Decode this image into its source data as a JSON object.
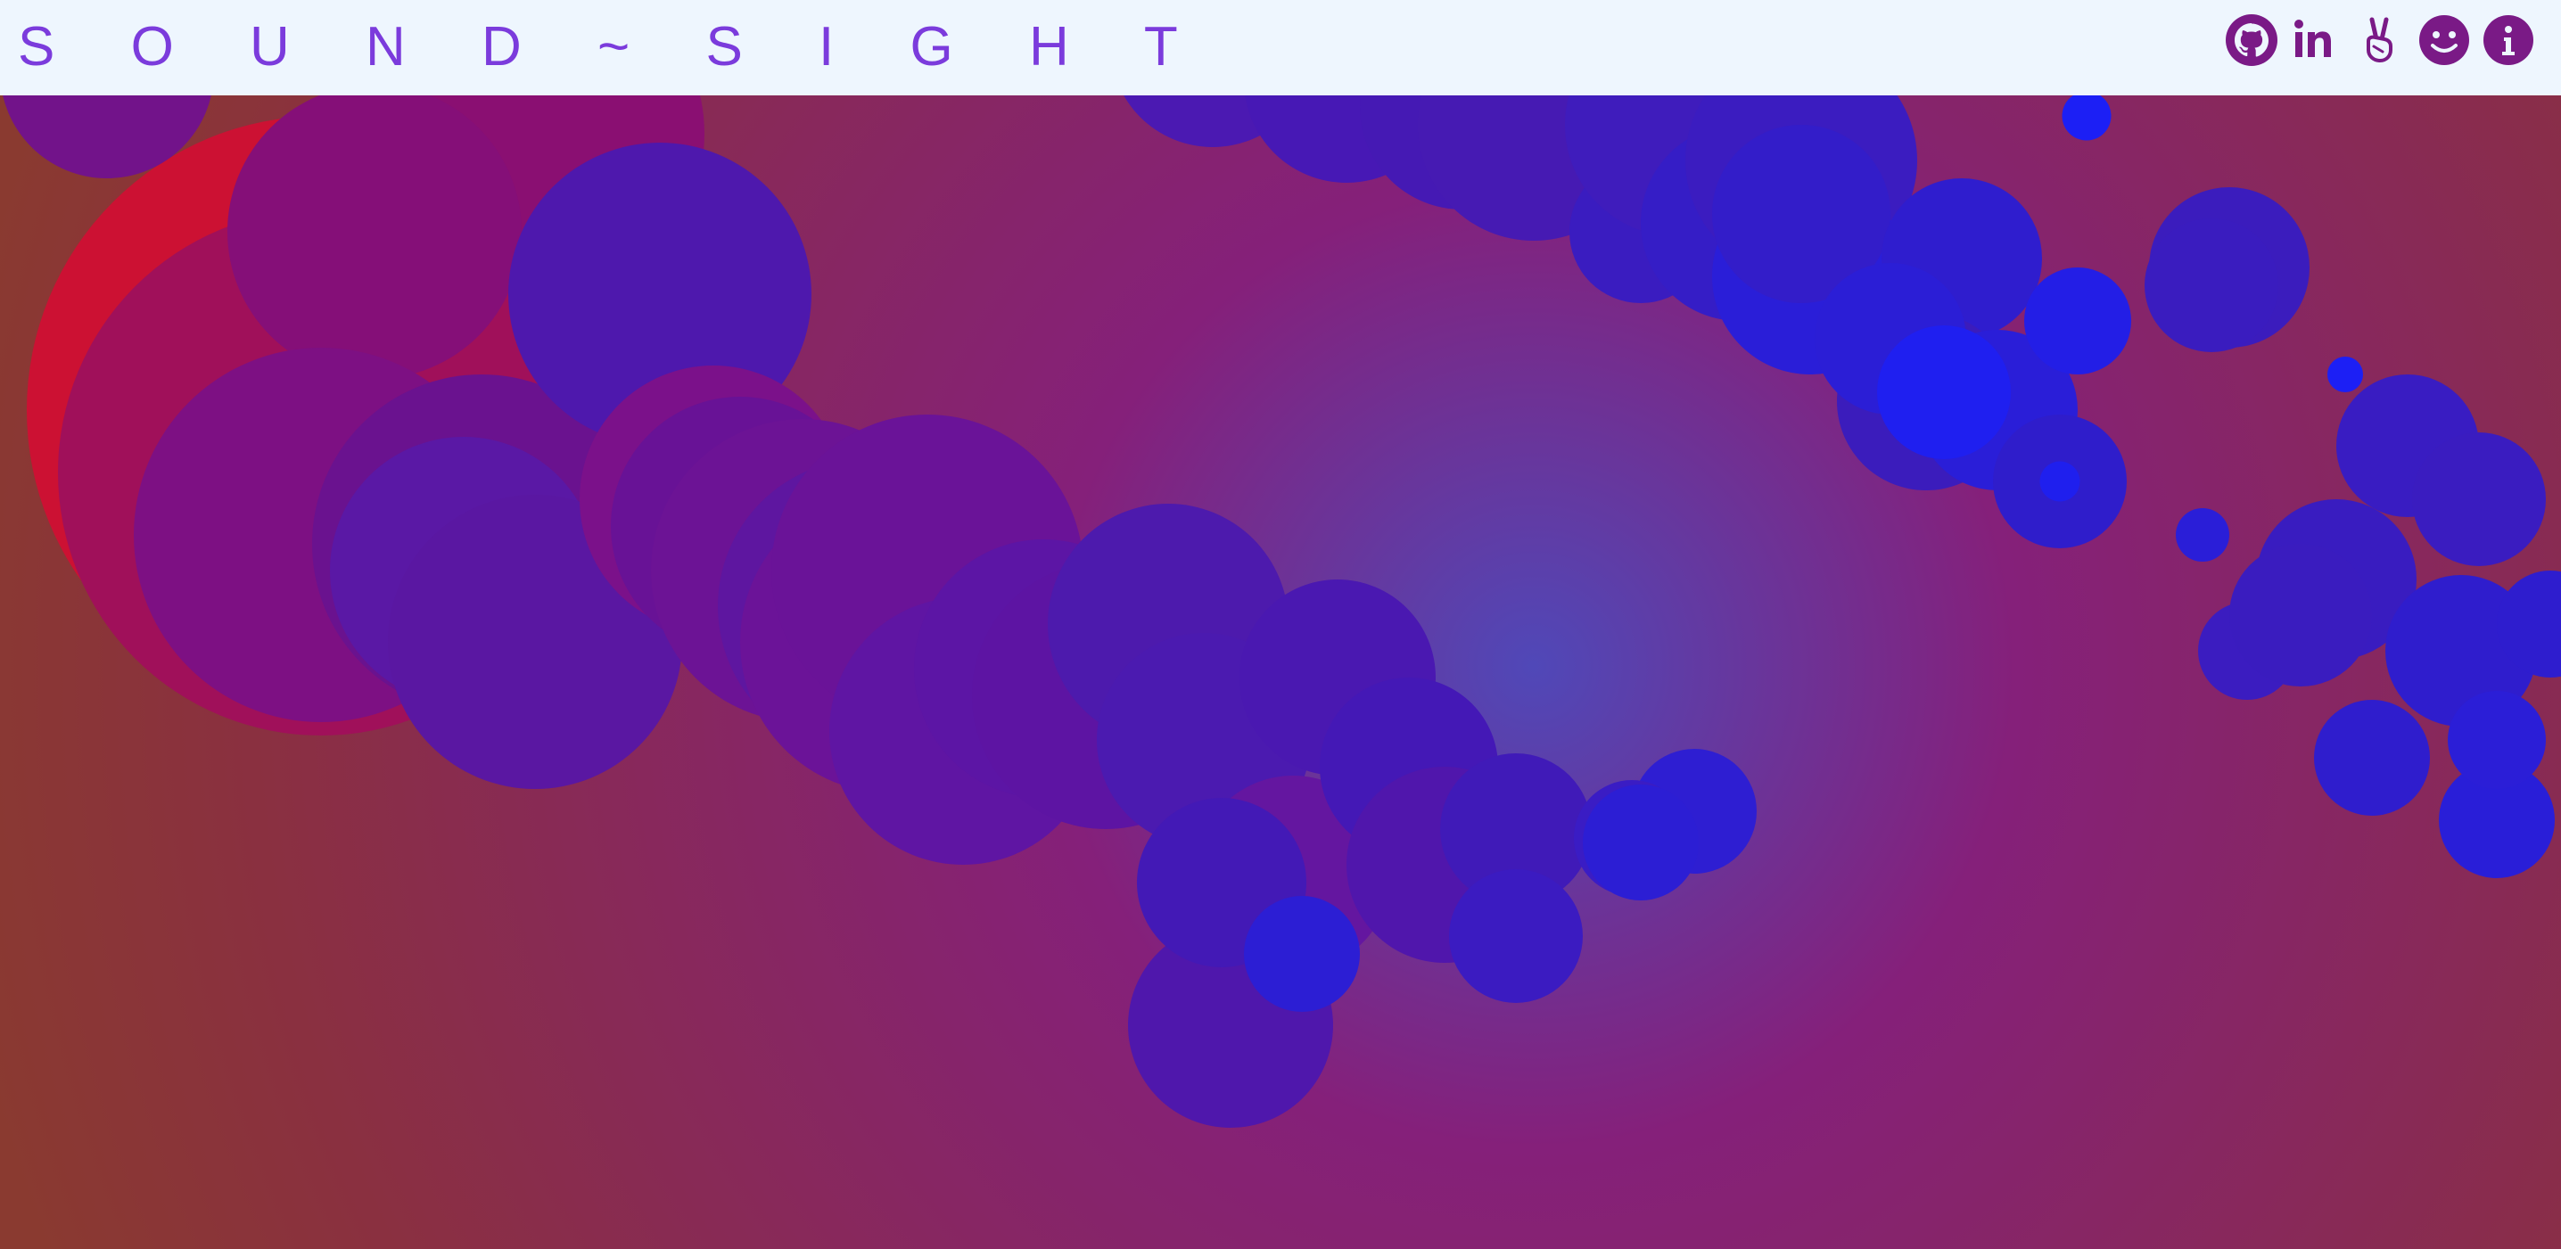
{
  "app": {
    "title": "S O U N D ~ S I G H T"
  },
  "nav": {
    "icons": [
      {
        "name": "github-icon"
      },
      {
        "name": "linkedin-icon"
      },
      {
        "name": "peace-hand-icon"
      },
      {
        "name": "smiley-icon"
      },
      {
        "name": "info-icon"
      }
    ]
  },
  "colors": {
    "accent": "#7b3bdc",
    "icon": "#7a1a86",
    "header_bg": "#eef6fe",
    "bg_center": "#5a46b0",
    "bg_mid": "#85207a",
    "bg_edge": "#8a3040",
    "circle_red": "#d0112f",
    "circle_blue": "#1c1cf0"
  }
}
